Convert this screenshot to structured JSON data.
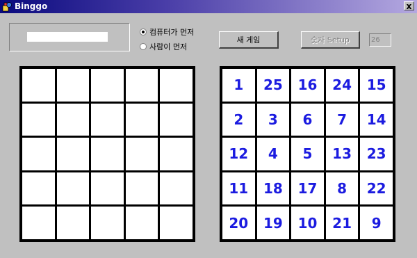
{
  "window": {
    "title": "Binggo",
    "close_label": "x"
  },
  "options": {
    "computer_first": "컴퓨터가 먼저",
    "person_first": "사람이 먼저",
    "selected": "computer_first"
  },
  "buttons": {
    "new_game": "새 게임",
    "number_setup": "숫자 Setup"
  },
  "setup_field_value": "26",
  "left_board": {
    "cells": [
      "",
      "",
      "",
      "",
      "",
      "",
      "",
      "",
      "",
      "",
      "",
      "",
      "",
      "",
      "",
      "",
      "",
      "",
      "",
      "",
      "",
      "",
      "",
      "",
      ""
    ]
  },
  "right_board": {
    "cells": [
      "1",
      "25",
      "16",
      "24",
      "15",
      "2",
      "3",
      "6",
      "7",
      "14",
      "12",
      "4",
      "5",
      "13",
      "23",
      "11",
      "18",
      "17",
      "8",
      "22",
      "20",
      "19",
      "10",
      "21",
      "9"
    ]
  }
}
